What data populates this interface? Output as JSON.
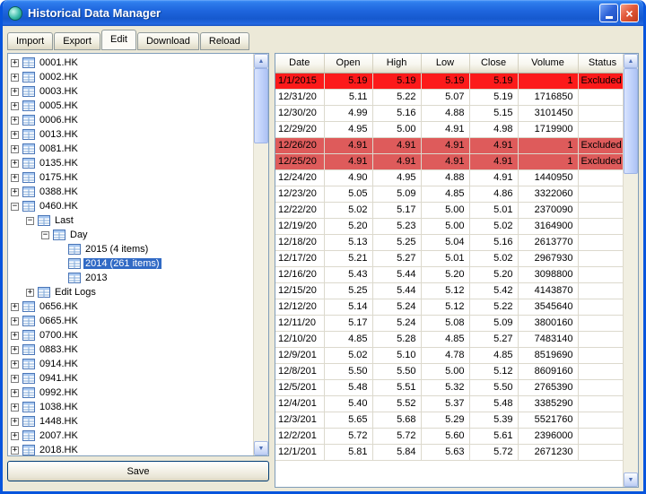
{
  "window": {
    "title": "Historical Data Manager"
  },
  "titlebar": {
    "minimize_icon": "minimize",
    "close_icon": "close",
    "close_glyph": "×"
  },
  "tabs": [
    {
      "label": "Import",
      "active": false
    },
    {
      "label": "Export",
      "active": false
    },
    {
      "label": "Edit",
      "active": true
    },
    {
      "label": "Download",
      "active": false
    },
    {
      "label": "Reload",
      "active": false
    }
  ],
  "tree": {
    "items": [
      {
        "level": 0,
        "expand": "+",
        "label": "0001.HK"
      },
      {
        "level": 0,
        "expand": "+",
        "label": "0002.HK"
      },
      {
        "level": 0,
        "expand": "+",
        "label": "0003.HK"
      },
      {
        "level": 0,
        "expand": "+",
        "label": "0005.HK"
      },
      {
        "level": 0,
        "expand": "+",
        "label": "0006.HK"
      },
      {
        "level": 0,
        "expand": "+",
        "label": "0013.HK"
      },
      {
        "level": 0,
        "expand": "+",
        "label": "0081.HK"
      },
      {
        "level": 0,
        "expand": "+",
        "label": "0135.HK"
      },
      {
        "level": 0,
        "expand": "+",
        "label": "0175.HK"
      },
      {
        "level": 0,
        "expand": "+",
        "label": "0388.HK"
      },
      {
        "level": 0,
        "expand": "-",
        "label": "0460.HK"
      },
      {
        "level": 1,
        "expand": "-",
        "label": "Last"
      },
      {
        "level": 2,
        "expand": "-",
        "label": "Day"
      },
      {
        "level": 3,
        "expand": null,
        "label": "2015 (4 items)"
      },
      {
        "level": 3,
        "expand": null,
        "label": "2014 (261 items)",
        "selected": true
      },
      {
        "level": 3,
        "expand": null,
        "label": "2013"
      },
      {
        "level": 1,
        "expand": "+",
        "label": "Edit Logs"
      },
      {
        "level": 0,
        "expand": "+",
        "label": "0656.HK"
      },
      {
        "level": 0,
        "expand": "+",
        "label": "0665.HK"
      },
      {
        "level": 0,
        "expand": "+",
        "label": "0700.HK"
      },
      {
        "level": 0,
        "expand": "+",
        "label": "0883.HK"
      },
      {
        "level": 0,
        "expand": "+",
        "label": "0914.HK"
      },
      {
        "level": 0,
        "expand": "+",
        "label": "0941.HK"
      },
      {
        "level": 0,
        "expand": "+",
        "label": "0992.HK"
      },
      {
        "level": 0,
        "expand": "+",
        "label": "1038.HK"
      },
      {
        "level": 0,
        "expand": "+",
        "label": "1448.HK"
      },
      {
        "level": 0,
        "expand": "+",
        "label": "2007.HK"
      },
      {
        "level": 0,
        "expand": "+",
        "label": "2018.HK"
      }
    ]
  },
  "save_button": {
    "label": "Save"
  },
  "table": {
    "columns": [
      "Date",
      "Open",
      "High",
      "Low",
      "Close",
      "Volume",
      "Status"
    ],
    "rows": [
      {
        "date": "1/1/2015",
        "open": "5.19",
        "high": "5.19",
        "low": "5.19",
        "close": "5.19",
        "volume": "1",
        "status": "Excluded",
        "highlight": "bright"
      },
      {
        "date": "12/31/20",
        "open": "5.11",
        "high": "5.22",
        "low": "5.07",
        "close": "5.19",
        "volume": "1716850",
        "status": "",
        "highlight": null
      },
      {
        "date": "12/30/20",
        "open": "4.99",
        "high": "5.16",
        "low": "4.88",
        "close": "5.15",
        "volume": "3101450",
        "status": "",
        "highlight": null
      },
      {
        "date": "12/29/20",
        "open": "4.95",
        "high": "5.00",
        "low": "4.91",
        "close": "4.98",
        "volume": "1719900",
        "status": "",
        "highlight": null
      },
      {
        "date": "12/26/20",
        "open": "4.91",
        "high": "4.91",
        "low": "4.91",
        "close": "4.91",
        "volume": "1",
        "status": "Excluded",
        "highlight": "muted"
      },
      {
        "date": "12/25/20",
        "open": "4.91",
        "high": "4.91",
        "low": "4.91",
        "close": "4.91",
        "volume": "1",
        "status": "Excluded",
        "highlight": "muted"
      },
      {
        "date": "12/24/20",
        "open": "4.90",
        "high": "4.95",
        "low": "4.88",
        "close": "4.91",
        "volume": "1440950",
        "status": "",
        "highlight": null
      },
      {
        "date": "12/23/20",
        "open": "5.05",
        "high": "5.09",
        "low": "4.85",
        "close": "4.86",
        "volume": "3322060",
        "status": "",
        "highlight": null
      },
      {
        "date": "12/22/20",
        "open": "5.02",
        "high": "5.17",
        "low": "5.00",
        "close": "5.01",
        "volume": "2370090",
        "status": "",
        "highlight": null
      },
      {
        "date": "12/19/20",
        "open": "5.20",
        "high": "5.23",
        "low": "5.00",
        "close": "5.02",
        "volume": "3164900",
        "status": "",
        "highlight": null
      },
      {
        "date": "12/18/20",
        "open": "5.13",
        "high": "5.25",
        "low": "5.04",
        "close": "5.16",
        "volume": "2613770",
        "status": "",
        "highlight": null
      },
      {
        "date": "12/17/20",
        "open": "5.21",
        "high": "5.27",
        "low": "5.01",
        "close": "5.02",
        "volume": "2967930",
        "status": "",
        "highlight": null
      },
      {
        "date": "12/16/20",
        "open": "5.43",
        "high": "5.44",
        "low": "5.20",
        "close": "5.20",
        "volume": "3098800",
        "status": "",
        "highlight": null
      },
      {
        "date": "12/15/20",
        "open": "5.25",
        "high": "5.44",
        "low": "5.12",
        "close": "5.42",
        "volume": "4143870",
        "status": "",
        "highlight": null
      },
      {
        "date": "12/12/20",
        "open": "5.14",
        "high": "5.24",
        "low": "5.12",
        "close": "5.22",
        "volume": "3545640",
        "status": "",
        "highlight": null
      },
      {
        "date": "12/11/20",
        "open": "5.17",
        "high": "5.24",
        "low": "5.08",
        "close": "5.09",
        "volume": "3800160",
        "status": "",
        "highlight": null
      },
      {
        "date": "12/10/20",
        "open": "4.85",
        "high": "5.28",
        "low": "4.85",
        "close": "5.27",
        "volume": "7483140",
        "status": "",
        "highlight": null
      },
      {
        "date": "12/9/201",
        "open": "5.02",
        "high": "5.10",
        "low": "4.78",
        "close": "4.85",
        "volume": "8519690",
        "status": "",
        "highlight": null
      },
      {
        "date": "12/8/201",
        "open": "5.50",
        "high": "5.50",
        "low": "5.00",
        "close": "5.12",
        "volume": "8609160",
        "status": "",
        "highlight": null
      },
      {
        "date": "12/5/201",
        "open": "5.48",
        "high": "5.51",
        "low": "5.32",
        "close": "5.50",
        "volume": "2765390",
        "status": "",
        "highlight": null
      },
      {
        "date": "12/4/201",
        "open": "5.40",
        "high": "5.52",
        "low": "5.37",
        "close": "5.48",
        "volume": "3385290",
        "status": "",
        "highlight": null
      },
      {
        "date": "12/3/201",
        "open": "5.65",
        "high": "5.68",
        "low": "5.29",
        "close": "5.39",
        "volume": "5521760",
        "status": "",
        "highlight": null
      },
      {
        "date": "12/2/201",
        "open": "5.72",
        "high": "5.72",
        "low": "5.60",
        "close": "5.61",
        "volume": "2396000",
        "status": "",
        "highlight": null
      },
      {
        "date": "12/1/201",
        "open": "5.81",
        "high": "5.84",
        "low": "5.63",
        "close": "5.72",
        "volume": "2671230",
        "status": "",
        "highlight": null
      }
    ]
  },
  "colors": {
    "excluded_row_bright": "#FC1A1A",
    "excluded_row_muted": "#DE5B5B",
    "tree_selection": "#316AC5",
    "title_bar_blue": "#1E65DD"
  }
}
